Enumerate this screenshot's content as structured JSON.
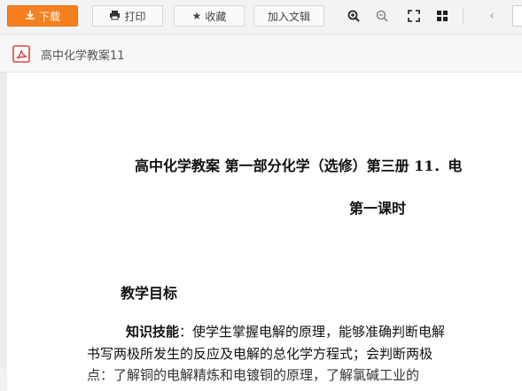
{
  "toolbar": {
    "download_label": "下载",
    "print_label": "打印",
    "favorite_label": "收藏",
    "add_to_library_label": "加入文辑"
  },
  "file": {
    "name": "高中化学教案11"
  },
  "document": {
    "title": "高中化学教案 第一部分化学（选修）第三册 11．电",
    "subtitle": "第一课时",
    "section_heading": "教学目标",
    "skills_label": "知识技能",
    "skills_text": "：使学生掌握电解的原理，能够准确判断电解",
    "line2": "书写两极所发生的反应及电解的总化学方程式；会判断两极",
    "line3": "点：了解铜的电解精炼和电镀铜的原理，了解氯碱工业的"
  },
  "colors": {
    "accent": "#f6801f",
    "pdf_icon": "#e0433b"
  }
}
